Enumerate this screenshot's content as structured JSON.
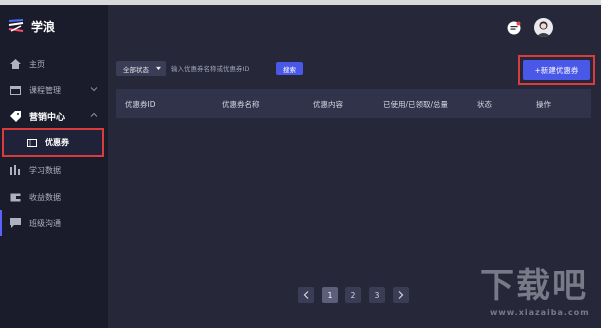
{
  "app": {
    "name": "学浪"
  },
  "sidebar": {
    "items": [
      {
        "label": "主页"
      },
      {
        "label": "课程管理"
      },
      {
        "label": "营销中心"
      },
      {
        "label": "优惠券"
      },
      {
        "label": "学习数据"
      },
      {
        "label": "收益数据"
      },
      {
        "label": "班级沟通"
      }
    ]
  },
  "toolbar": {
    "status_select": "全部状态",
    "search_placeholder": "输入优惠券名称或优惠券ID",
    "search_button": "搜索",
    "new_button": "+新建优惠券"
  },
  "table": {
    "columns": [
      "优惠券ID",
      "优惠券名称",
      "优惠内容",
      "已使用/已领取/总量",
      "状态",
      "操作"
    ]
  },
  "pagination": {
    "pages": [
      "1",
      "2",
      "3"
    ],
    "current": "1"
  },
  "watermark": {
    "big": "下载吧",
    "small": "www.xiazaiba.com"
  },
  "colors": {
    "accent": "#4a58e8",
    "highlight": "#d83c3c",
    "sidebar_bg": "#1b1c2b",
    "content_bg": "#26283a"
  }
}
